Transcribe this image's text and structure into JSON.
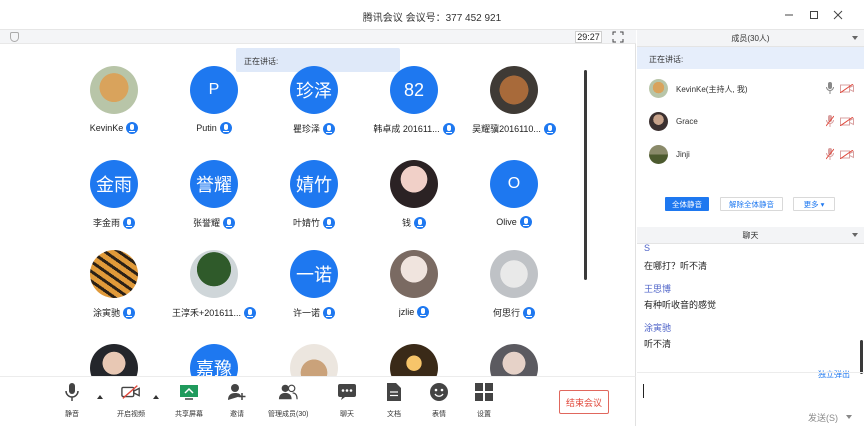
{
  "window": {
    "title": "腾讯会议 会议号：377 452 921"
  },
  "meeting": {
    "timer": "29:27",
    "speaking_popup": "正在讲话:"
  },
  "participants": [
    {
      "name": "KevinKe",
      "avatar_text": "",
      "photo": "dog-golden",
      "host": true
    },
    {
      "name": "Putin",
      "avatar_text": "P"
    },
    {
      "name": "瞿珍泽",
      "avatar_text": "珍泽"
    },
    {
      "name": "韩卓成 201611...",
      "avatar_text": "82"
    },
    {
      "name": "吴耀骥2016110...",
      "avatar_text": "",
      "photo": "dog-brown"
    },
    {
      "name": "李金雨",
      "avatar_text": "金雨"
    },
    {
      "name": "张誉耀",
      "avatar_text": "誉耀"
    },
    {
      "name": "叶婧竹",
      "avatar_text": "婧竹"
    },
    {
      "name": "钱",
      "avatar_text": "",
      "photo": "girl-pink"
    },
    {
      "name": "Olive",
      "avatar_text": "O"
    },
    {
      "name": "涂寅驰",
      "avatar_text": "",
      "photo": "tiger"
    },
    {
      "name": "王淳禾+201611...",
      "avatar_text": "",
      "photo": "tree"
    },
    {
      "name": "许一诺",
      "avatar_text": "一诺"
    },
    {
      "name": "jzlie",
      "avatar_text": "",
      "photo": "girl-white"
    },
    {
      "name": "何思行",
      "avatar_text": "",
      "photo": "cat-glasses"
    },
    {
      "name": "",
      "avatar_text": "",
      "photo": "boy"
    },
    {
      "name": "",
      "avatar_text": "嘉豫"
    },
    {
      "name": "",
      "avatar_text": "",
      "photo": "guitar"
    },
    {
      "name": "",
      "avatar_text": "",
      "photo": "night-lights"
    },
    {
      "name": "",
      "avatar_text": "",
      "photo": "girl-window"
    }
  ],
  "toolbar": {
    "mute": "静音",
    "video": "开启视频",
    "share": "共享屏幕",
    "invite": "邀请",
    "members": "管理成员(30)",
    "chat": "聊天",
    "docs": "文档",
    "emoji": "表情",
    "settings": "设置",
    "end": "结束会议"
  },
  "members_panel": {
    "header": "成员(30人)",
    "speaking": "正在讲话:",
    "members": [
      {
        "name": "KevinKe(主持人, 我)",
        "mic_on": true,
        "photo": "dog-golden"
      },
      {
        "name": "Grace",
        "mic_on": false,
        "photo": "dark-portrait"
      },
      {
        "name": "Jinji",
        "mic_on": false,
        "photo": "field"
      }
    ],
    "mute_all": "全体静音",
    "unmute_all": "解除全体静音",
    "more": "更多"
  },
  "chat_panel": {
    "header": "聊天",
    "messages": [
      {
        "name": "S",
        "text": "在哪打？听不清"
      },
      {
        "name": "王思博",
        "text": "有种听收音的感觉"
      },
      {
        "name": "涂寅驰",
        "text": "听不清"
      }
    ],
    "popout": "独立弹出",
    "send": "发送(S)"
  },
  "colors": {
    "accent": "#1e78f0",
    "end": "#e0473a",
    "chat_name": "#4e63c8"
  }
}
